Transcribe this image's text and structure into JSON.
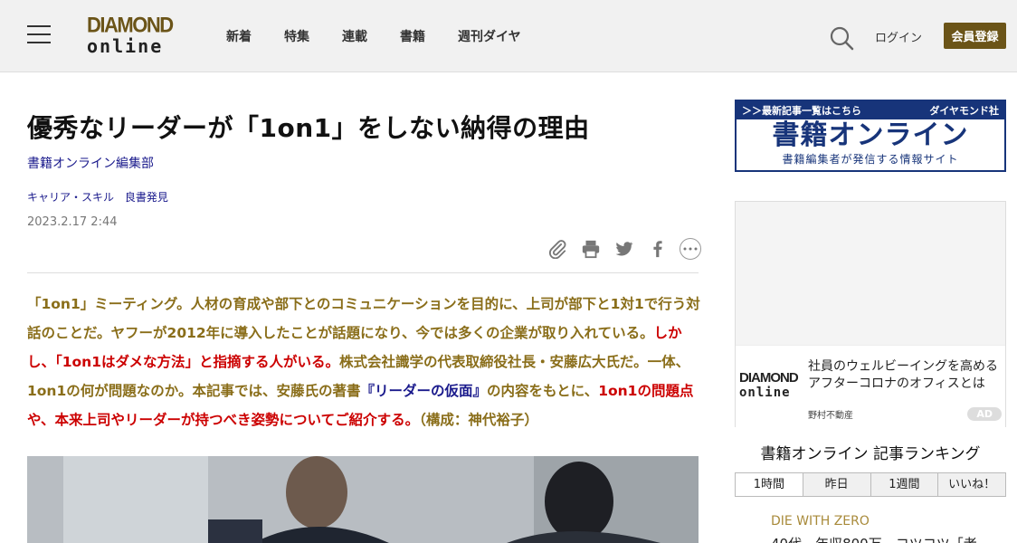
{
  "header": {
    "logo_top": "DIAMOND",
    "logo_bottom": "online",
    "nav": [
      "新着",
      "特集",
      "連載",
      "書籍",
      "週刊ダイヤ"
    ],
    "login": "ログイン",
    "register": "会員登録"
  },
  "article": {
    "title": "優秀なリーダーが「1on1」をしない納得の理由",
    "author": "書籍オンライン編集部",
    "tags": [
      "キャリア・スキル",
      "良書発見"
    ],
    "date": "2023.2.17 2:44",
    "lead": {
      "p1": "「1on1」ミーティング。人材の育成や部下とのコミュニケーションを目的に、上司が部下と1対1で行う対話のことだ。ヤフーが2012年に導入したことが話題になり、今では多くの企業が取り入れている。",
      "p2": "しかし、「1on1はダメな方法」と指摘する人がいる。",
      "p3": "株式会社識学の代表取締役社長・安藤広大氏だ。一体、1on1の何が問題なのか。本記事では、安藤氏の著書",
      "book": "『リーダーの仮面』",
      "p4": "の内容をもとに、",
      "p5": "1on1の問題点や、本来上司やリーダーが持つべき姿勢についてご紹介する。",
      "p6": "（構成：神代裕子）"
    }
  },
  "sidebar": {
    "banner": {
      "top_left": "＞＞最新記事一覧はこちら",
      "top_right": "ダイヤモンド社",
      "main": "書籍オンライン",
      "sub": "書籍編集者が発信する情報サイト"
    },
    "ad": {
      "logo_top": "DIAMOND",
      "logo_bottom": "online",
      "text": "社員のウェルビーイングを高めるアフターコロナのオフィスとは",
      "sponsor": "野村不動産",
      "badge": "AD"
    },
    "ranking": {
      "title": "書籍オンライン 記事ランキング",
      "tabs": [
        "1時間",
        "昨日",
        "1週間",
        "いいね！"
      ],
      "category": "DIE WITH ZERO",
      "item": "40代、年収800万、コツコツ「老"
    }
  },
  "colors": {
    "brand_gold": "#6b5418",
    "lead_gold": "#8a6e1a",
    "lead_red": "#cc0000",
    "link_blue": "#1a1a8c",
    "banner_navy": "#17347a"
  },
  "icons": [
    "menu-icon",
    "search-icon",
    "clip-icon",
    "print-icon",
    "twitter-icon",
    "facebook-icon",
    "more-icon"
  ]
}
